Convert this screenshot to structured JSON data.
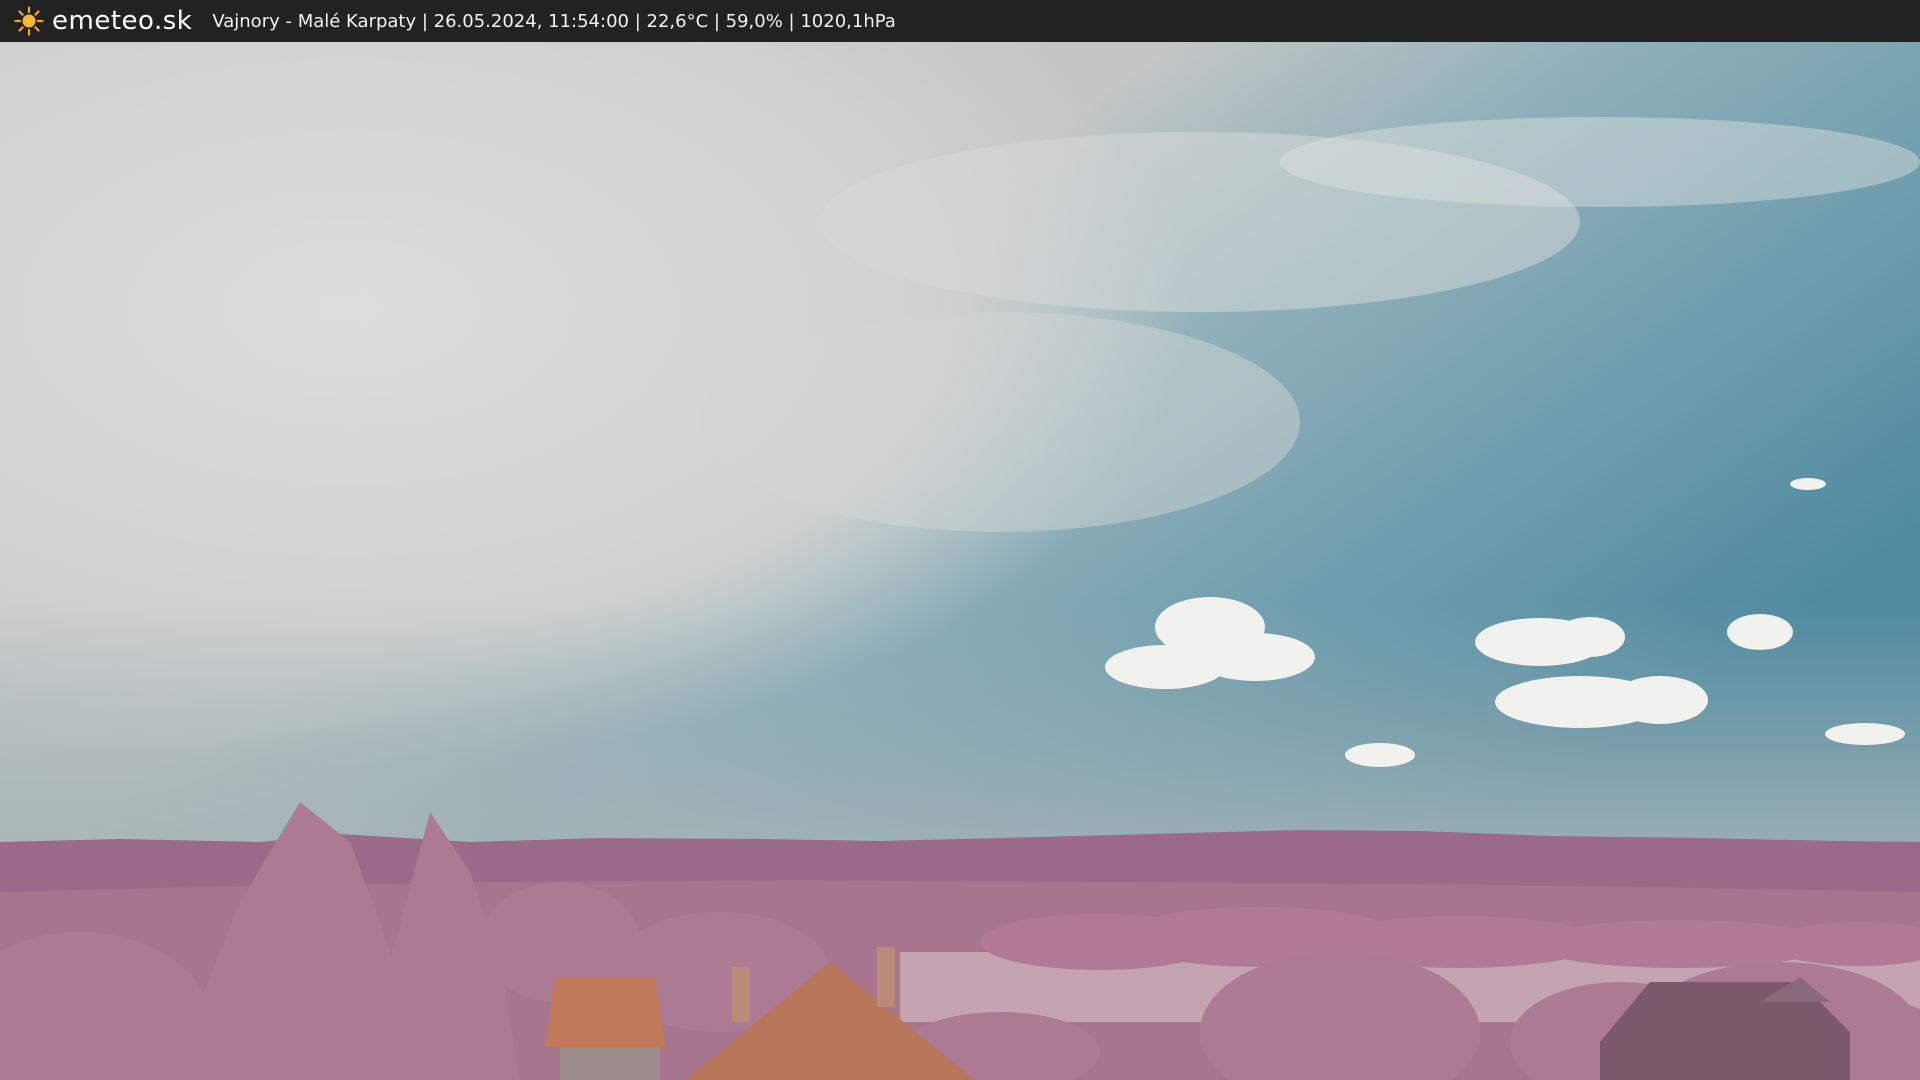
{
  "header": {
    "brand": "emeteo.sk",
    "logo_icon": "sun-icon",
    "location": "Vajnory - Malé Karpaty",
    "datetime": "26.05.2024, 11:54:00",
    "temperature": "22,6°C",
    "humidity": "59,0%",
    "pressure": "1020,1hPa",
    "caption": "Vajnory - Malé Karpaty | 26.05.2024, 11:54:00 | 22,6°C | 59,0% | 1020,1hPa"
  },
  "colors": {
    "header_bg": "#222222",
    "sun": "#f5a623",
    "sky_blue": "#5f93a6",
    "cloud": "#d9dbd8",
    "hills": "#9a6a88",
    "trees": "#b07a96",
    "roof": "#c07a5a"
  }
}
